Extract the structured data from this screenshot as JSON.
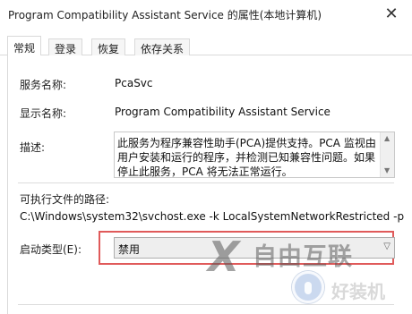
{
  "window": {
    "title": "Program Compatibility Assistant Service 的属性(本地计算机)",
    "close_icon": "close-icon"
  },
  "tabs": [
    {
      "label": "常规",
      "active": true
    },
    {
      "label": "登录",
      "active": false
    },
    {
      "label": "恢复",
      "active": false
    },
    {
      "label": "依存关系",
      "active": false
    }
  ],
  "general": {
    "service_name_label": "服务名称:",
    "service_name_value": "PcaSvc",
    "display_name_label": "显示名称:",
    "display_name_value": "Program Compatibility Assistant Service",
    "description_label": "描述:",
    "description_value": "此服务为程序兼容性助手(PCA)提供支持。PCA 监视由用户安装和运行的程序，并检测已知兼容性问题。如果停止此服务，PCA 将无法正常运行。",
    "exe_path_label": "可执行文件的路径:",
    "exe_path_value": "C:\\Windows\\system32\\svchost.exe -k LocalSystemNetworkRestricted -p",
    "startup_type_label": "启动类型(E):",
    "startup_type_value": "禁用"
  },
  "watermark": {
    "brand_text": "自由互联",
    "sub_text": "好装机"
  },
  "colors": {
    "highlight_frame": "#e05a5a"
  }
}
